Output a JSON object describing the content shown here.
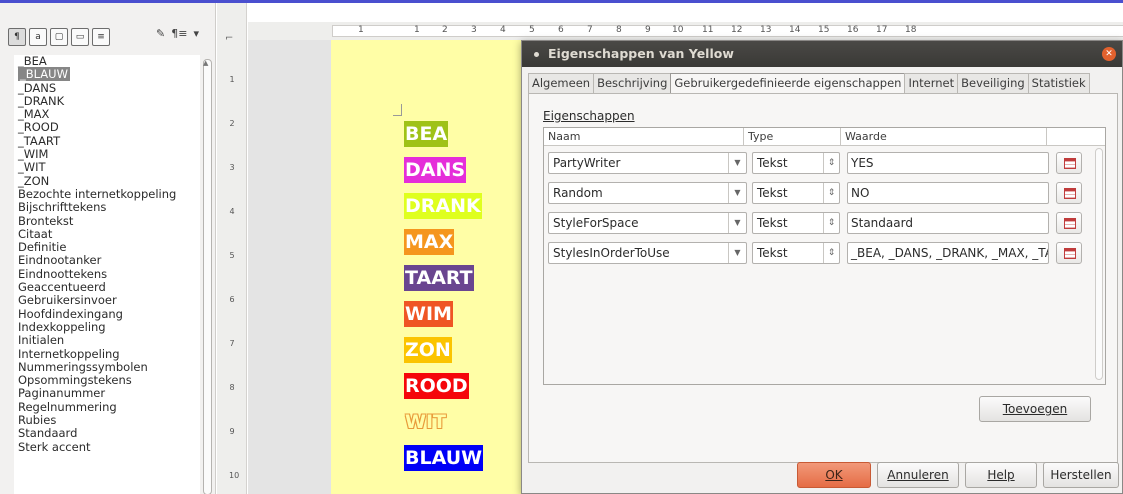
{
  "sidebar": {
    "toolbar_icons": [
      "paragraph-styles-icon",
      "character-styles-icon",
      "frame-styles-icon",
      "page-styles-icon",
      "list-styles-icon",
      "fill-format-icon",
      "new-style-icon",
      "dropdown-icon"
    ],
    "style_list": [
      "_BEA",
      "_BLAUW",
      "_DANS",
      "_DRANK",
      "_MAX",
      "_ROOD",
      "_TAART",
      "_WIM",
      "_WIT",
      "_ZON",
      "Bezochte internetkoppeling",
      "Bijschrifttekens",
      "Brontekst",
      "Citaat",
      "Definitie",
      "Eindnootanker",
      "Eindnoottekens",
      "Geaccentueerd",
      "Gebruikersinvoer",
      "Hoofdindexingang",
      "Indexkoppeling",
      "Initialen",
      "Internetkoppeling",
      "Nummeringssymbolen",
      "Opsommingstekens",
      "Paginanummer",
      "Regelnummering",
      "Rubies",
      "Standaard",
      "Sterk accent"
    ],
    "selected_index": 1
  },
  "ruler": {
    "horizontal_numbers": [
      "1",
      "1",
      "2",
      "3",
      "4",
      "5",
      "6",
      "7",
      "8",
      "9",
      "10",
      "11",
      "12",
      "13",
      "14",
      "15",
      "16",
      "17",
      "18"
    ],
    "vertical_numbers": [
      "1",
      "2",
      "3",
      "4",
      "5",
      "6",
      "7",
      "8",
      "9",
      "10"
    ]
  },
  "document": {
    "words": [
      {
        "text": "BEA",
        "color": "#9fc217"
      },
      {
        "text": "DANS",
        "color": "#e52ed9"
      },
      {
        "text": "DRANK",
        "color": "#dfff1e"
      },
      {
        "text": "MAX",
        "color": "#f5961e"
      },
      {
        "text": "TAART",
        "color": "#6a4590"
      },
      {
        "text": "WIM",
        "color": "#ef5524"
      },
      {
        "text": "ZON",
        "color": "#fbc400"
      },
      {
        "text": "ROOD",
        "color": "#f5060a"
      },
      {
        "text": "WIT",
        "color": "#fffea6"
      },
      {
        "text": "BLAUW",
        "color": "#0000f7"
      }
    ]
  },
  "dialog": {
    "title": "Eigenschappen van Yellow",
    "tabs": [
      "Algemeen",
      "Beschrijving",
      "Gebruikergedefinieerde eigenschappen",
      "Internet",
      "Beveiliging",
      "Statistiek"
    ],
    "active_tab": 2,
    "section_label": "Eigenschappen",
    "columns": {
      "name": "Naam",
      "type": "Type",
      "value": "Waarde"
    },
    "properties": [
      {
        "name": "PartyWriter",
        "type": "Tekst",
        "value": "YES"
      },
      {
        "name": "Random",
        "type": "Tekst",
        "value": "NO"
      },
      {
        "name": "StyleForSpace",
        "type": "Tekst",
        "value": "Standaard"
      },
      {
        "name": "StylesInOrderToUse",
        "type": "Tekst",
        "value": "_BEA, _DANS, _DRANK, _MAX, _TA"
      }
    ],
    "add_button": "Toevoegen",
    "buttons": {
      "ok": "OK",
      "cancel": "Annuleren",
      "help": "Help",
      "reset": "Herstellen"
    }
  }
}
